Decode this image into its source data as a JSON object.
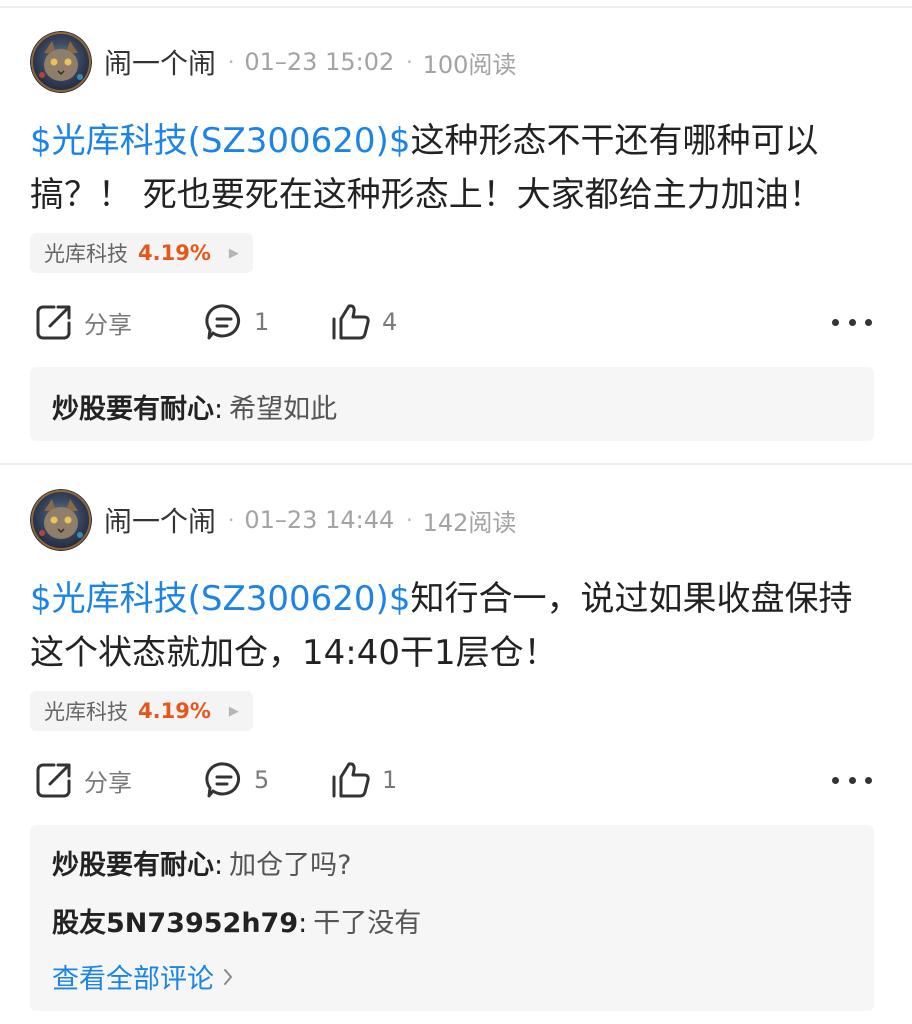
{
  "posts": [
    {
      "author": "闹一个闹",
      "time": "01–23 15:02",
      "reads": "100阅读",
      "stock_tag": "$光库科技(SZ300620)$",
      "text": "这种形态不干还有哪种可以搞？！ 死也要死在这种形态上！大家都给主力加油！",
      "chip": {
        "name": "光库科技",
        "change": "4.19%"
      },
      "actions": {
        "share_label": "分享",
        "comments": "1",
        "likes": "4"
      },
      "replies": [
        {
          "author": "炒股要有耐心",
          "text": "希望如此"
        }
      ]
    },
    {
      "author": "闹一个闹",
      "time": "01–23 14:44",
      "reads": "142阅读",
      "stock_tag": "$光库科技(SZ300620)$",
      "text": "知行合一，说过如果收盘保持这个状态就加仓，14:40干1层仓！",
      "chip": {
        "name": "光库科技",
        "change": "4.19%"
      },
      "actions": {
        "share_label": "分享",
        "comments": "5",
        "likes": "1"
      },
      "replies": [
        {
          "author": "炒股要有耐心",
          "text": "加仓了吗?"
        },
        {
          "author": "股友5N73952h79",
          "text": "干了没有"
        }
      ],
      "view_all_label": "查看全部评论"
    }
  ],
  "colors": {
    "link_blue": "#1b84e6",
    "change_orange": "#e5571a",
    "reply_bg": "#f6f6f7"
  },
  "icons": {
    "share": "share-icon",
    "comment": "comment-icon",
    "like": "thumbs-up-icon",
    "more": "more-dots-icon",
    "chip_arrow": "triangle-right-icon",
    "view_all_arrow": "chevron-right-icon"
  }
}
